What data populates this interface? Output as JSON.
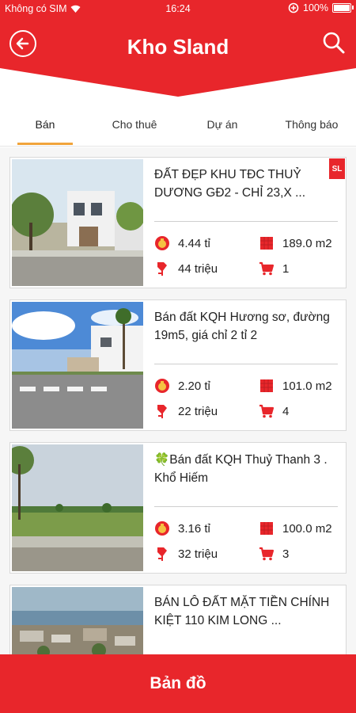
{
  "status_bar": {
    "carrier": "Không có SIM",
    "time": "16:24",
    "battery": "100%"
  },
  "header": {
    "title": "Kho Sland"
  },
  "tabs": [
    {
      "label": "Bán"
    },
    {
      "label": "Cho thuê"
    },
    {
      "label": "Dự án"
    },
    {
      "label": "Thông báo"
    }
  ],
  "listings": [
    {
      "title": "ĐẤT ĐẸP KHU TĐC THUỶ DƯƠNG GĐ2 - CHỈ 23,X ...",
      "price": "4.44 tỉ",
      "area": "189.0 m2",
      "price_per_m2": "44 triệu",
      "count": "1",
      "badge": "SL"
    },
    {
      "title": "Bán đất KQH Hương sơ, đường 19m5, giá chỉ 2 tỉ 2",
      "price": "2.20 tỉ",
      "area": "101.0 m2",
      "price_per_m2": "22 triệu",
      "count": "4"
    },
    {
      "title": "🍀Bán đất KQH Thuỷ Thanh 3 . Khổ Hiếm",
      "price": "3.16 tỉ",
      "area": "100.0 m2",
      "price_per_m2": "32 triệu",
      "count": "3"
    },
    {
      "title": "BÁN LÔ ĐẤT MẶT TIỀN CHÍNH KIỆT 110 KIM LONG ...",
      "price": "",
      "area": "",
      "price_per_m2": "",
      "count": ""
    }
  ],
  "bottom_button": {
    "label": "Bản đồ"
  },
  "colors": {
    "primary": "#e8262b",
    "tab_indicator": "#f1a43b"
  },
  "icons": [
    "back-icon",
    "search-icon",
    "money-bag-icon",
    "area-icon",
    "price-tag-icon",
    "cart-icon"
  ]
}
